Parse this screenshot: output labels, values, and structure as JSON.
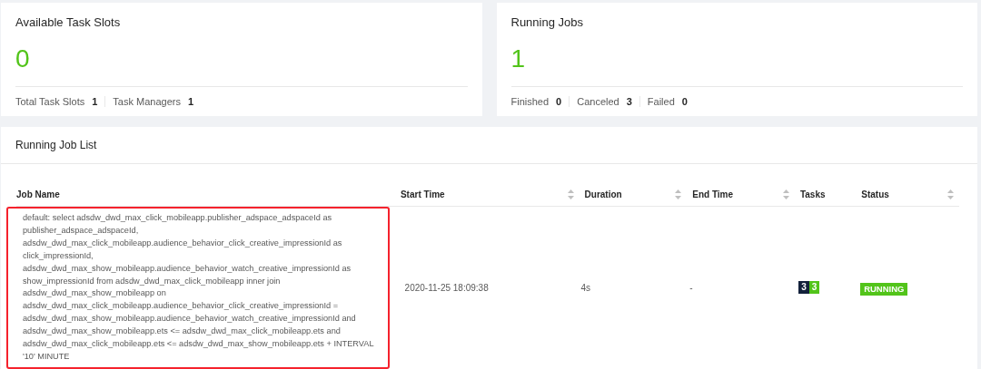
{
  "stat_cards": [
    {
      "title": "Available Task Slots",
      "value": "0",
      "stats": [
        {
          "label": "Total Task Slots",
          "value": "1"
        },
        {
          "label": "Task Managers",
          "value": "1"
        }
      ]
    },
    {
      "title": "Running Jobs",
      "value": "1",
      "stats": [
        {
          "label": "Finished",
          "value": "0"
        },
        {
          "label": "Canceled",
          "value": "3"
        },
        {
          "label": "Failed",
          "value": "0"
        }
      ]
    }
  ],
  "job_list": {
    "title": "Running Job List",
    "columns": [
      {
        "label": "Job Name",
        "sortable": false
      },
      {
        "label": "Start Time",
        "sortable": true
      },
      {
        "label": "Duration",
        "sortable": true
      },
      {
        "label": "End Time",
        "sortable": true
      },
      {
        "label": "Tasks",
        "sortable": false
      },
      {
        "label": "Status",
        "sortable": true
      }
    ],
    "rows": [
      {
        "highlighted": true,
        "job_name": "default: select adsdw_dwd_max_click_mobileapp.publisher_adspace_adspaceId as publisher_adspace_adspaceId, adsdw_dwd_max_click_mobileapp.audience_behavior_click_creative_impressionId as click_impressionId, adsdw_dwd_max_show_mobileapp.audience_behavior_watch_creative_impressionId as show_impressionId from adsdw_dwd_max_click_mobileapp inner join adsdw_dwd_max_show_mobileapp on adsdw_dwd_max_click_mobileapp.audience_behavior_click_creative_impressionId = adsdw_dwd_max_show_mobileapp.audience_behavior_watch_creative_impressionId and adsdw_dwd_max_show_mobileapp.ets <= adsdw_dwd_max_click_mobileapp.ets and adsdw_dwd_max_click_mobileapp.ets <= adsdw_dwd_max_show_mobileapp.ets + INTERVAL '10' MINUTE",
        "start_time": "2020-11-25 18:09:38",
        "duration": "4s",
        "end_time": "-",
        "tasks": [
          {
            "count": "3",
            "color": "#13213b"
          },
          {
            "count": "3",
            "color": "#52c41a"
          }
        ],
        "status": {
          "label": "RUNNING",
          "color": "#52c41a"
        }
      }
    ]
  }
}
